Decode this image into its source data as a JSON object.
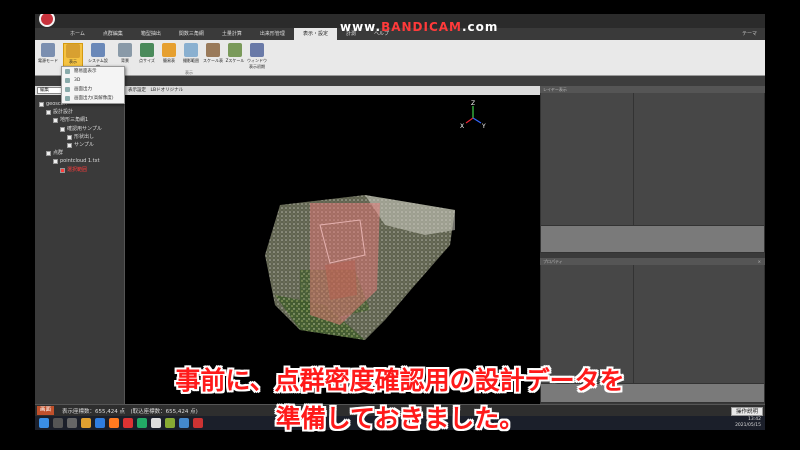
{
  "watermark": {
    "prefix": "www.",
    "brand": "BANDICAM",
    "suffix": ".com"
  },
  "menu": {
    "tabs": [
      "ホーム",
      "点群編集",
      "箱型抽出",
      "関数三角網",
      "土量計算",
      "出来形管理",
      "表示・設定",
      "計測",
      "ヘルプ"
    ],
    "active_index": 6,
    "theme_label": "テーマ"
  },
  "ribbon": {
    "buttons": [
      {
        "label": "電源モード",
        "icon": "power-mode-icon"
      },
      {
        "label": "表示",
        "icon": "display-icon"
      },
      {
        "label": "システム設定",
        "icon": "system-settings-icon"
      },
      {
        "label": "背景",
        "icon": "background-icon"
      },
      {
        "label": "点サイズ",
        "icon": "point-size-icon"
      },
      {
        "label": "簡易表",
        "icon": "quick-table-icon"
      },
      {
        "label": "撮影範囲",
        "icon": "capture-range-icon"
      },
      {
        "label": "スケール表",
        "icon": "scale-icon"
      },
      {
        "label": "Zスケール",
        "icon": "z-scale-icon"
      },
      {
        "label": "ウィンドウ表示初期",
        "icon": "window-reset-icon"
      }
    ],
    "selected_index": 1,
    "group_label": "表示"
  },
  "dropdown": {
    "items": [
      "簡易面表示",
      "3D",
      "画面出力",
      "画面出力(高解像度)"
    ]
  },
  "toolbar": {
    "mode_select": "編集",
    "view_label": "表示設定",
    "view_tab": "LBドオリジナル"
  },
  "tree": {
    "items": [
      {
        "label": "geoscan",
        "level": 0,
        "red": false
      },
      {
        "label": "設計設計",
        "level": 1,
        "red": false
      },
      {
        "label": "地形三角網1",
        "level": 2,
        "red": false
      },
      {
        "label": "確認用サンプル",
        "level": 3,
        "red": false
      },
      {
        "label": "形状出し",
        "level": 4,
        "red": false
      },
      {
        "label": "サンプル",
        "level": 4,
        "red": false
      },
      {
        "label": "点群",
        "level": 1,
        "red": false
      },
      {
        "label": "pointcloud 1.txt",
        "level": 2,
        "red": false
      },
      {
        "label": "選択範囲",
        "level": 3,
        "red": true
      }
    ]
  },
  "axis": {
    "z": "Z",
    "x": "X",
    "y": "Y"
  },
  "right_panel": {
    "top_title": "レイヤー表示",
    "bottom_title": "プロパティ",
    "close_glyph": "×"
  },
  "status": {
    "mode": "画面",
    "text": "表示座標数：655,424 点　(取込座標数：655,424 点)",
    "help_button": "操作説明"
  },
  "taskbar": {
    "time": "13:42",
    "date": "2021/05/15"
  },
  "subtitle": {
    "line1": "事前に、点群密度確認用の設計データを",
    "line2": "準備しておきました。"
  },
  "colors": {
    "accent": "#c0502b",
    "ribbon_selected": "#f5c342",
    "subtitle": "#ff1a1a",
    "tree_highlight": "#ff3b3b"
  }
}
